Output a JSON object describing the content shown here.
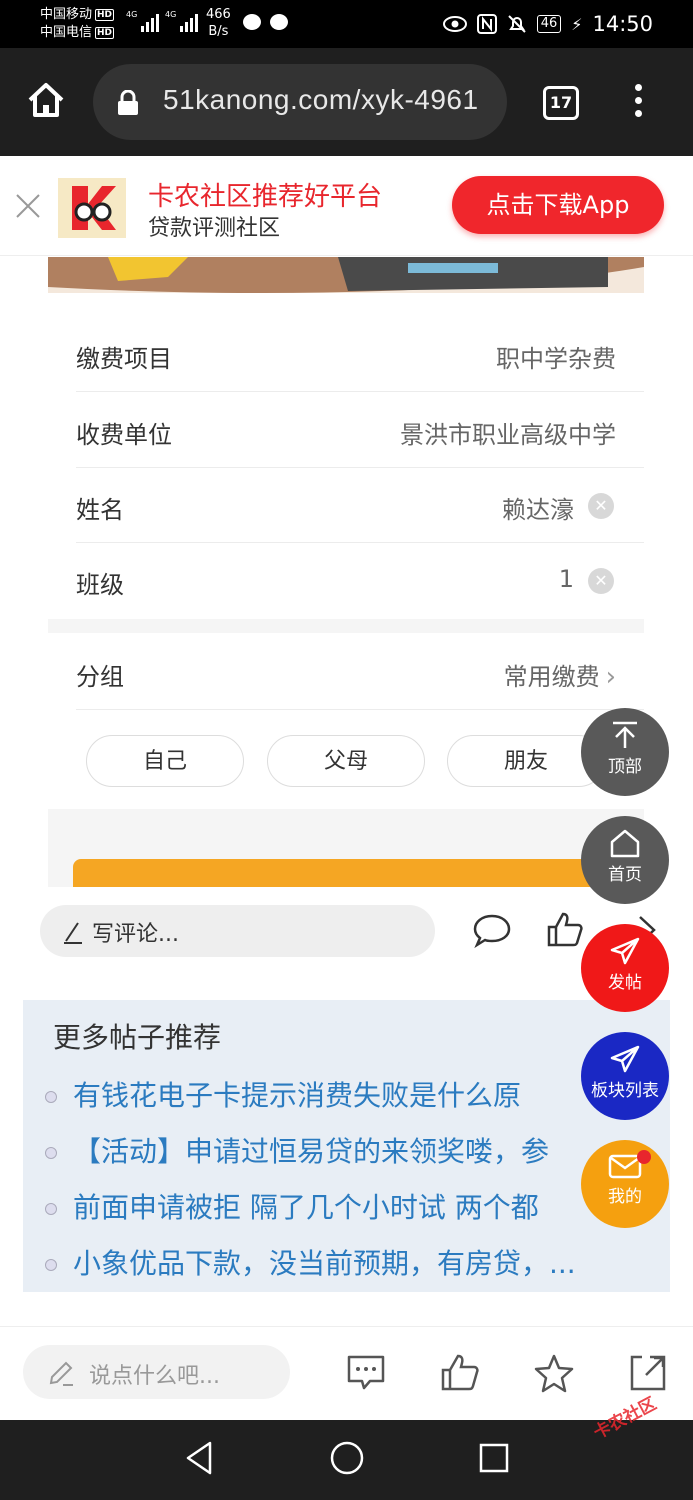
{
  "status_bar": {
    "carrier1": "中国移动",
    "carrier2": "中国电信",
    "hd": "HD",
    "signal1_type": "4G",
    "signal2_type": "4G",
    "net_speed_value": "466",
    "net_speed_unit": "B/s",
    "battery": "46",
    "time": "14:50"
  },
  "browser": {
    "url": "51kanong.com/xyk-4961",
    "tab_count": "17"
  },
  "app_banner": {
    "title": "卡农社区推荐好平台",
    "subtitle": "贷款评测社区",
    "download_label": "点击下载App"
  },
  "form": {
    "rows": [
      {
        "label": "缴费项目",
        "value": "职中学杂费"
      },
      {
        "label": "收费单位",
        "value": "景洪市职业高级中学"
      },
      {
        "label": "姓名",
        "value": "赖达濠"
      },
      {
        "label": "班级",
        "value": "1"
      }
    ],
    "group": {
      "label": "分组",
      "value": "常用缴费"
    },
    "pills": [
      "自己",
      "父母",
      "朋友"
    ]
  },
  "comment_bar": {
    "placeholder": "写评论..."
  },
  "more_posts": {
    "title": "更多帖子推荐",
    "items": [
      "有钱花电子卡提示消费失败是什么原",
      "【活动】申请过恒易贷的来领奖喽，参",
      "前面申请被拒 隔了几个小时试 两个都",
      "小象优品下款，没当前预期，有房贷，..."
    ]
  },
  "floating": {
    "top": "顶部",
    "home": "首页",
    "post": "发帖",
    "forum": "板块列表",
    "me": "我的"
  },
  "bottom_bar": {
    "placeholder": "说点什么吧..."
  },
  "watermark": "卡农社区",
  "colors": {
    "brand_red": "#e8262d",
    "link_blue": "#2b7bc0",
    "orange": "#f5a623",
    "forum_blue": "#1a28c4"
  }
}
